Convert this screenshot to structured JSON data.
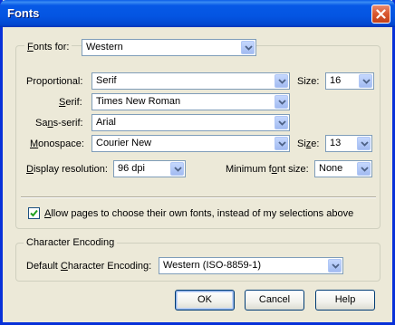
{
  "window": {
    "title": "Fonts"
  },
  "fonts_group": {
    "fonts_for_label": "Fonts for:",
    "fonts_for_value": "Western",
    "proportional_label": "Proportional:",
    "proportional_value": "Serif",
    "size_label": "Size:",
    "proportional_size": "16",
    "serif_label": "Serif:",
    "serif_value": "Times New Roman",
    "sans_serif_label": "Sans-serif:",
    "sans_serif_value": "Arial",
    "monospace_label": "Monospace:",
    "monospace_value": "Courier New",
    "monospace_size_label": "Size:",
    "monospace_size": "13",
    "display_resolution_label": "Display resolution:",
    "display_resolution_value": "96 dpi",
    "min_font_size_label": "Minimum font size:",
    "min_font_size_value": "None",
    "allow_pages_label": "Allow pages to choose their own fonts, instead of my selections above",
    "allow_pages_checked": true
  },
  "encoding_group": {
    "title": "Character Encoding",
    "default_label": "Default Character Encoding:",
    "default_value": "Western (ISO-8859-1)"
  },
  "buttons": {
    "ok": "OK",
    "cancel": "Cancel",
    "help": "Help"
  },
  "icons": {
    "close": "close-icon",
    "dropdown": "chevron-down-icon",
    "check": "check-icon"
  },
  "colors": {
    "titlebar": "#0455e2",
    "dialog_bg": "#ece9d8",
    "close_button": "#d9562e"
  }
}
